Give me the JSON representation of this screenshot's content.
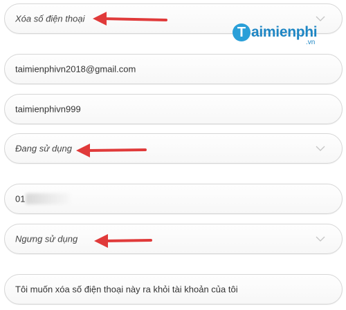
{
  "form": {
    "status_select_1": "Xóa số điện thoại",
    "email": "taimienphivn2018@gmail.com",
    "username": "taimienphivn999",
    "status_select_2": "Đang sử dụng",
    "phone_prefix": "01",
    "status_select_3": "Ngưng sử dụng",
    "note": "Tôi muốn xóa số điện thoại này ra khỏi tài khoản của tôi"
  },
  "watermark": {
    "letter": "T",
    "brand": "aimienphi",
    "suffix": ".vn"
  },
  "colors": {
    "arrow": "#e03a3a",
    "brand": "#1e86c4"
  },
  "icons": [
    "chevron-down-icon",
    "red-arrow-annotation"
  ]
}
